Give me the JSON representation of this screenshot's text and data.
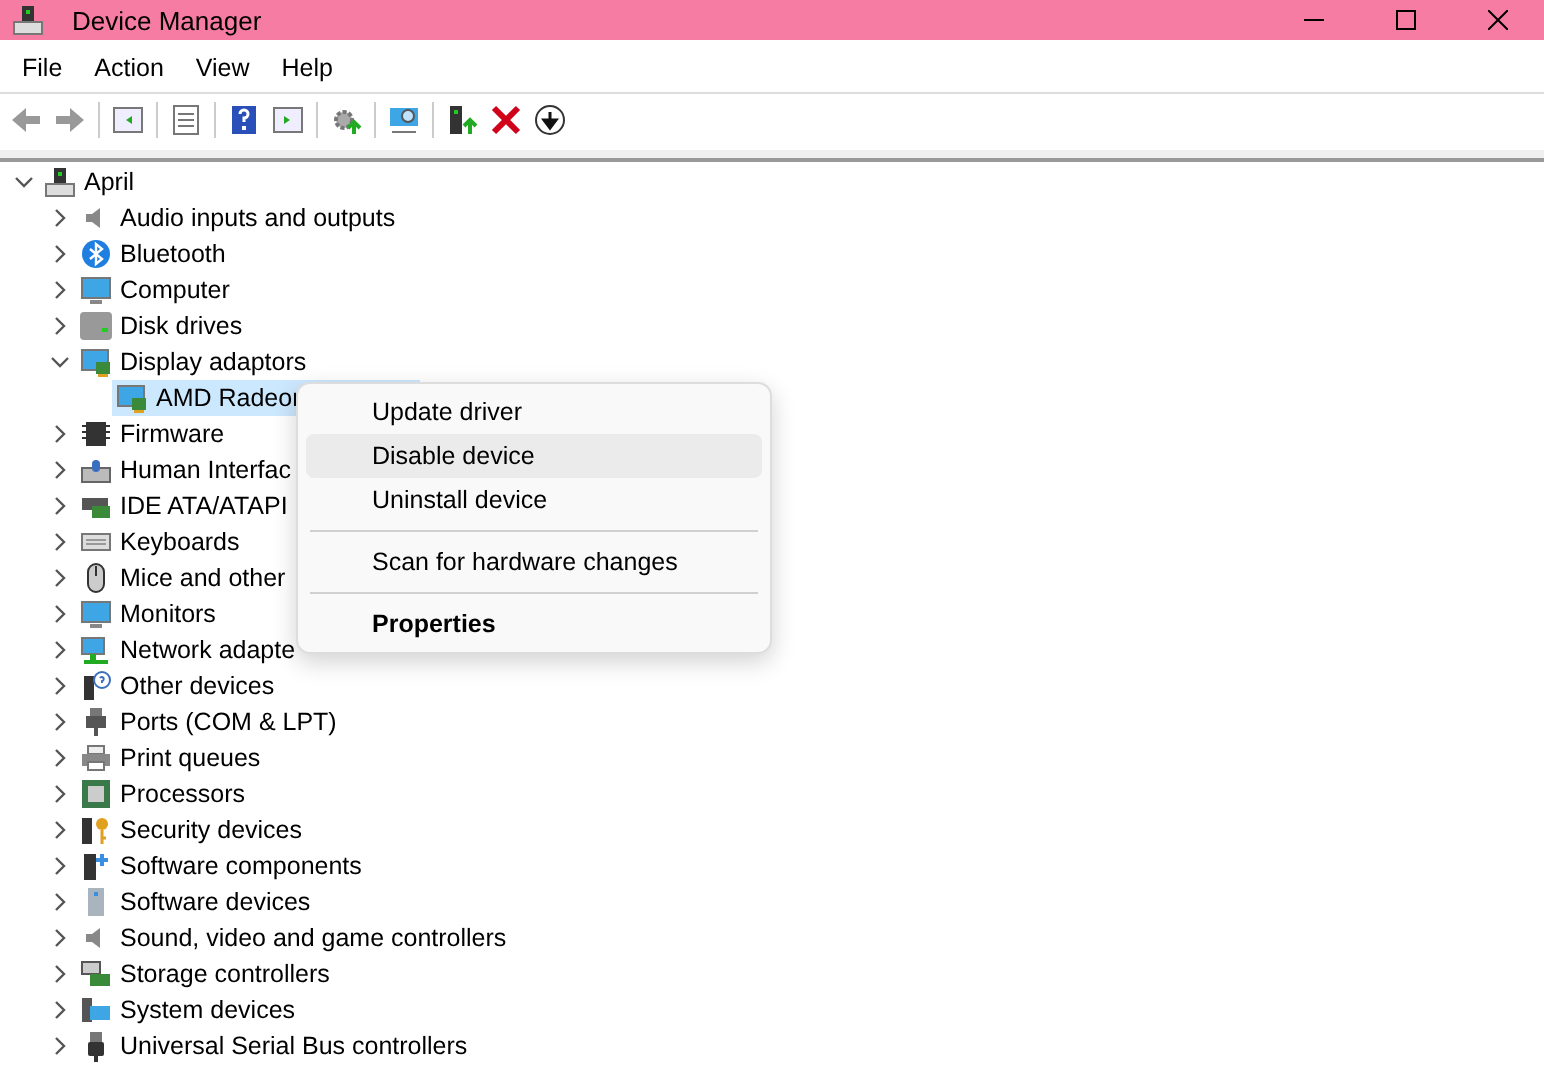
{
  "window": {
    "title": "Device Manager"
  },
  "menu_bar": [
    {
      "label": "File"
    },
    {
      "label": "Action"
    },
    {
      "label": "View"
    },
    {
      "label": "Help"
    }
  ],
  "tree": [
    {
      "label": "April",
      "expanded": true,
      "selected": false,
      "children": [
        {
          "label": "Audio inputs and outputs",
          "expanded": false,
          "selected": false
        },
        {
          "label": "Bluetooth",
          "expanded": false,
          "selected": false
        },
        {
          "label": "Computer",
          "expanded": false,
          "selected": false
        },
        {
          "label": "Disk drives",
          "expanded": false,
          "selected": false
        },
        {
          "label": "Display adaptors",
          "expanded": true,
          "selected": false,
          "children": [
            {
              "label": "AMD Radeor",
              "selected": true
            }
          ]
        },
        {
          "label": "Firmware",
          "expanded": false,
          "selected": false
        },
        {
          "label": "Human Interfac",
          "expanded": false,
          "selected": false
        },
        {
          "label": "IDE ATA/ATAPI",
          "expanded": false,
          "selected": false
        },
        {
          "label": "Keyboards",
          "expanded": false,
          "selected": false
        },
        {
          "label": "Mice and other",
          "expanded": false,
          "selected": false
        },
        {
          "label": "Monitors",
          "expanded": false,
          "selected": false
        },
        {
          "label": "Network adapte",
          "expanded": false,
          "selected": false
        },
        {
          "label": "Other devices",
          "expanded": false,
          "selected": false
        },
        {
          "label": "Ports (COM & LPT)",
          "expanded": false,
          "selected": false
        },
        {
          "label": "Print queues",
          "expanded": false,
          "selected": false
        },
        {
          "label": "Processors",
          "expanded": false,
          "selected": false
        },
        {
          "label": "Security devices",
          "expanded": false,
          "selected": false
        },
        {
          "label": "Software components",
          "expanded": false,
          "selected": false
        },
        {
          "label": "Software devices",
          "expanded": false,
          "selected": false
        },
        {
          "label": "Sound, video and game controllers",
          "expanded": false,
          "selected": false
        },
        {
          "label": "Storage controllers",
          "expanded": false,
          "selected": false
        },
        {
          "label": "System devices",
          "expanded": false,
          "selected": false
        },
        {
          "label": "Universal Serial Bus controllers",
          "expanded": false,
          "selected": false
        }
      ]
    }
  ],
  "context_menu": [
    {
      "kind": "command",
      "label": "Update driver",
      "highlighted": false,
      "default": false
    },
    {
      "kind": "command",
      "label": "Disable device",
      "highlighted": true,
      "default": false
    },
    {
      "kind": "command",
      "label": "Uninstall device",
      "highlighted": false,
      "default": false
    },
    {
      "kind": "separator"
    },
    {
      "kind": "command",
      "label": "Scan for hardware changes",
      "highlighted": false,
      "default": false
    },
    {
      "kind": "separator"
    },
    {
      "kind": "command",
      "label": "Properties",
      "highlighted": false,
      "default": true
    }
  ]
}
